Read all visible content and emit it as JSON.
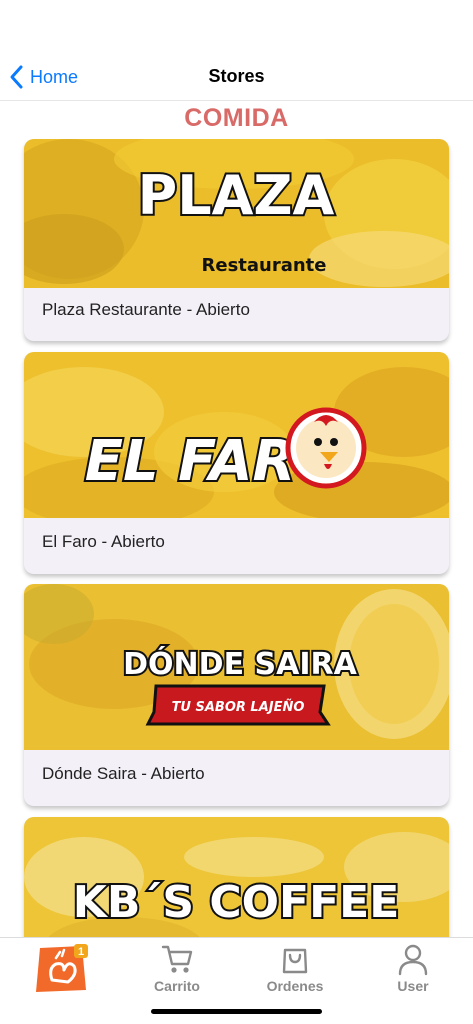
{
  "nav": {
    "back_label": "Home",
    "title": "Stores"
  },
  "section": {
    "title": "COMIDA"
  },
  "stores": [
    {
      "banner_title": "PLAZA",
      "banner_subtitle": "Restaurante",
      "label": "Plaza Restaurante - Abierto"
    },
    {
      "banner_title": "EL FARO",
      "label": "El Faro - Abierto"
    },
    {
      "banner_title": "DÓNDE SAIRA",
      "banner_subtitle": "TU SABOR LAJEÑO",
      "label": "Dónde Saira - Abierto"
    },
    {
      "banner_title": "KB´S COFFEE"
    }
  ],
  "tabbar": {
    "home_badge": "1",
    "cart_label": "Carrito",
    "orders_label": "Ordenes",
    "user_label": "User"
  },
  "colors": {
    "accent": "#0a7aff",
    "section_title": "#d86a68",
    "banner_yellow": "#f1c62a",
    "card_bg": "#f4f0f8",
    "tab_gray": "#8a8a8a",
    "home_orange": "#f26a2a"
  }
}
